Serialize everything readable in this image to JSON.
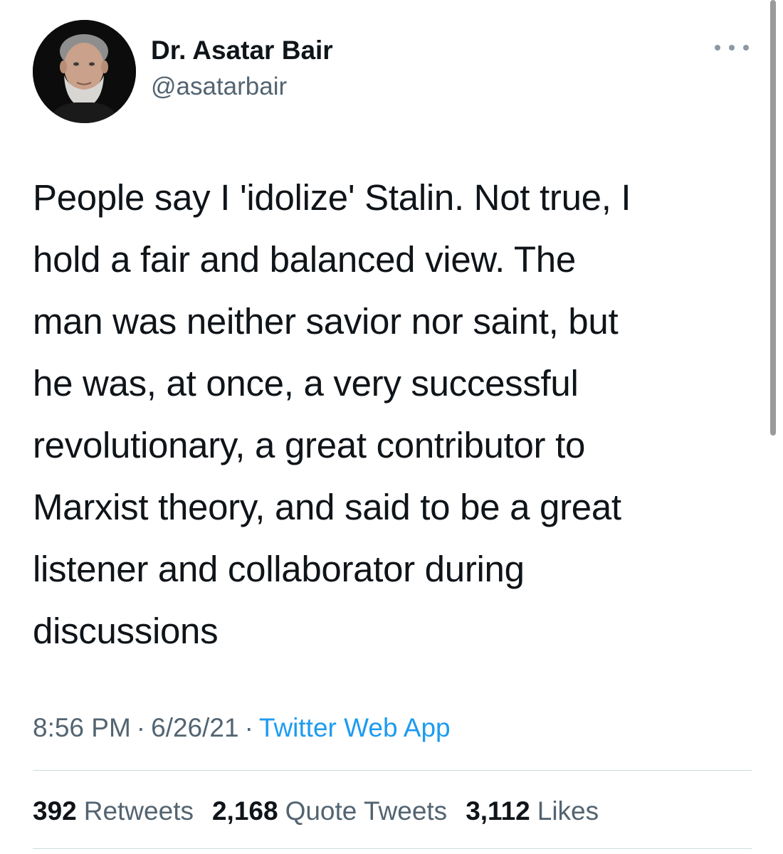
{
  "author": {
    "display_name": "Dr. Asatar Bair",
    "handle": "@asatarbair",
    "avatar_icon": "profile-photo"
  },
  "more_icon": "ellipsis-icon",
  "tweet": {
    "text": "People say I 'idolize' Stalin. Not true, I\nhold a fair and balanced view. The\nman was neither savior nor saint, but\nhe was, at once, a very successful\nrevolutionary, a great contributor to\nMarxist theory, and said to be a great\nlistener and collaborator during\ndiscussions"
  },
  "meta": {
    "time": "8:56 PM",
    "separator": "·",
    "date": "6/26/21",
    "source": "Twitter Web App"
  },
  "stats": {
    "retweets": {
      "count": "392",
      "label": "Retweets"
    },
    "quote_tweets": {
      "count": "2,168",
      "label": "Quote Tweets"
    },
    "likes": {
      "count": "3,112",
      "label": "Likes"
    }
  },
  "colors": {
    "text_primary": "#0f1419",
    "text_secondary": "#536471",
    "link": "#1d9bf0",
    "divider": "#cfd9de"
  }
}
